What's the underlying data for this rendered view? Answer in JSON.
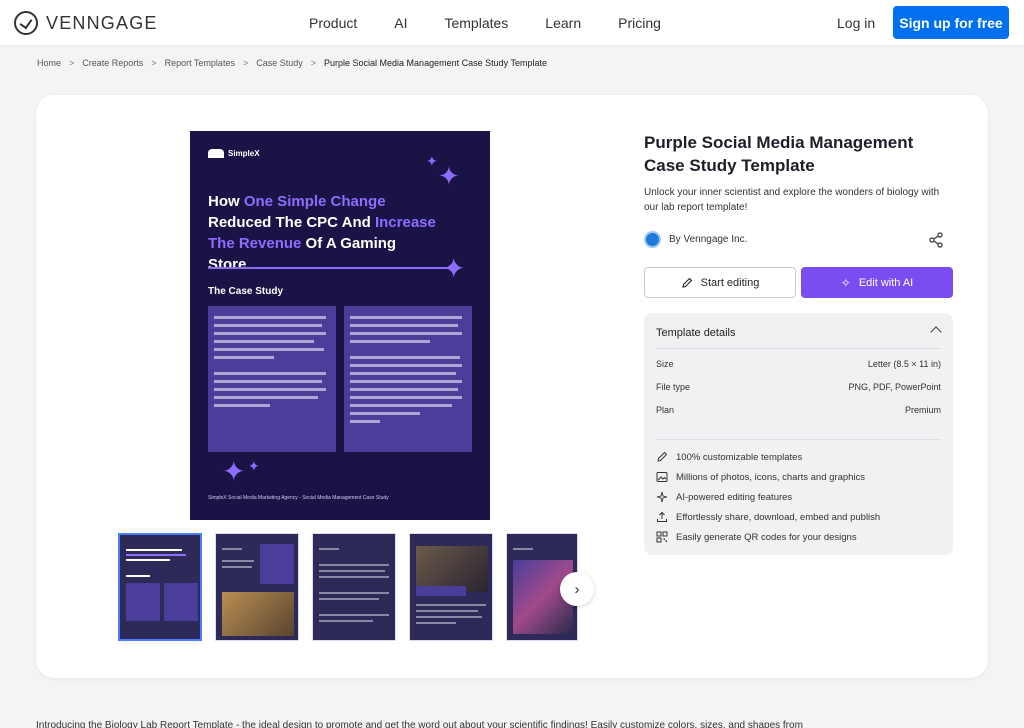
{
  "nav": {
    "brand": "VENNGAGE",
    "menu": [
      "Product",
      "AI",
      "Templates",
      "Learn",
      "Pricing"
    ],
    "login": "Log in",
    "signup": "Sign up for free"
  },
  "breadcrumb": [
    "Home",
    "Create Reports",
    "Report Templates",
    "Case Study",
    "Purple Social Media Management Case Study Template"
  ],
  "preview": {
    "brand": "SimpleX",
    "title_a": "How ",
    "title_hl1": "One Simple Change",
    "title_b": " Reduced The CPC And ",
    "title_hl2": "Increase The Revenue",
    "title_c": " Of A Gaming Store",
    "section": "The Case Study",
    "footer": "SimpleX Social Media Marketing Agency - Social Media Management Case Study"
  },
  "template": {
    "title": "Purple Social Media Management Case Study Template",
    "description": "Unlock your inner scientist and explore the wonders of biology with our lab report template!",
    "author": "By Venngage Inc.",
    "start_editing": "Start editing",
    "edit_ai": "Edit with AI"
  },
  "details": {
    "heading": "Template details",
    "rows": [
      {
        "label": "Size",
        "value": "Letter (8.5 × 11 in)"
      },
      {
        "label": "File type",
        "value": "PNG, PDF, PowerPoint"
      },
      {
        "label": "Plan",
        "value": "Premium"
      }
    ],
    "features": [
      {
        "icon": "pencil-icon",
        "text": "100% customizable templates"
      },
      {
        "icon": "image-icon",
        "text": "Millions of photos, icons, charts and graphics"
      },
      {
        "icon": "sparkle-icon",
        "text": "AI-powered editing features"
      },
      {
        "icon": "upload-icon",
        "text": "Effortlessly share, download, embed and publish"
      },
      {
        "icon": "qr-code-icon",
        "text": "Easily generate QR codes for your designs"
      }
    ]
  },
  "bottom": "Introducing the Biology Lab Report Template - the ideal design to promote and get the word out about your scientific findings! Easily customize colors, sizes, and shapes from",
  "colors": {
    "accent": "#0070f0",
    "ai": "#7b4df1",
    "preview_bg": "#1a1446",
    "highlight": "#8e6cff"
  }
}
